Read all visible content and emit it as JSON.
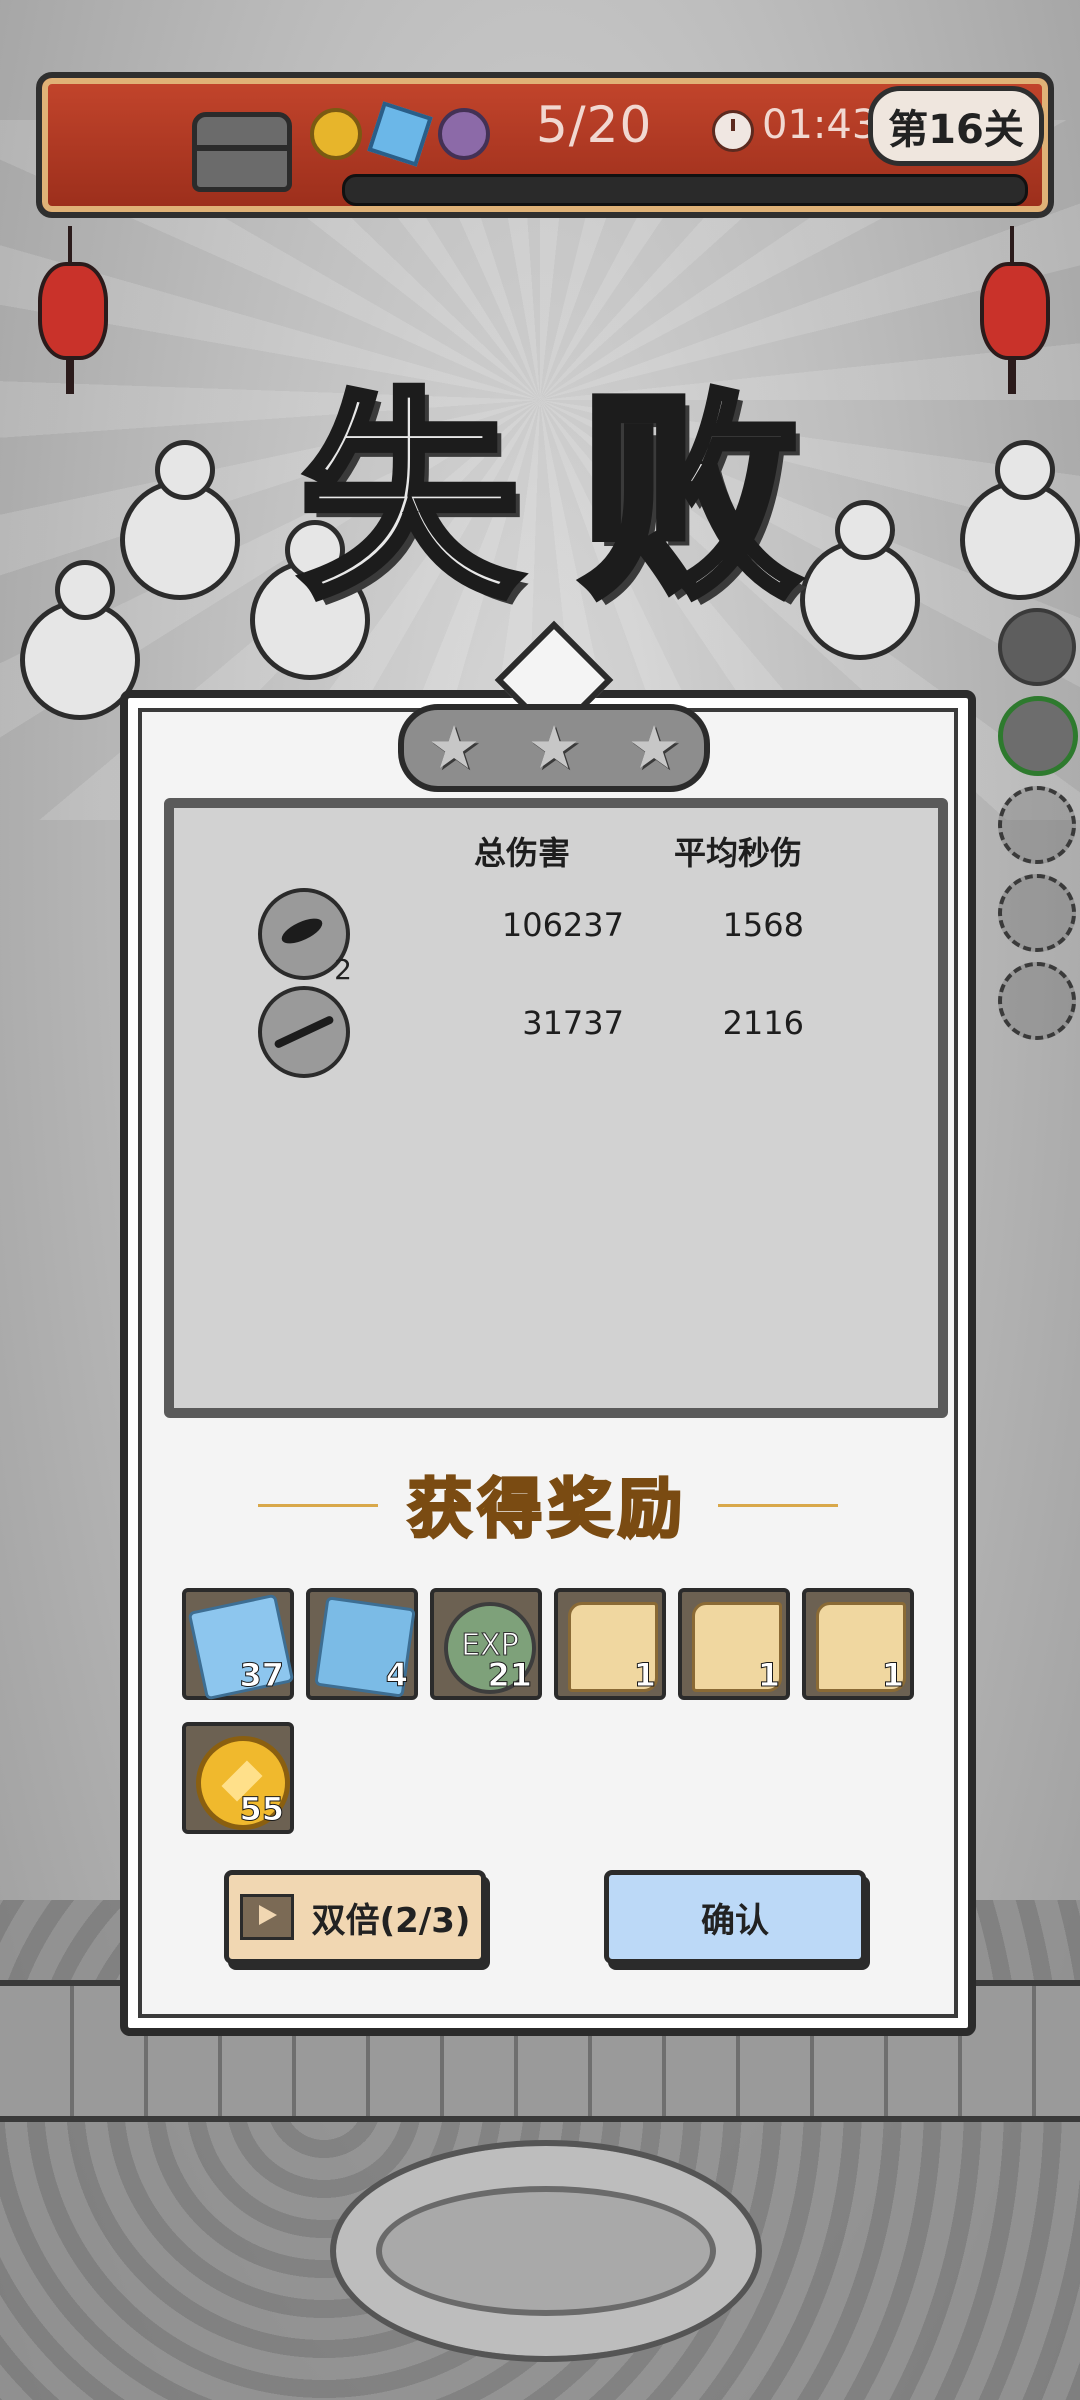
{
  "hud": {
    "wave": "5/20",
    "timer": "01:43",
    "level": "第16关",
    "progress_percent": 0,
    "icons": [
      "chest-icon",
      "coin-icon",
      "crystal-icon",
      "monster-icon",
      "clock-icon"
    ]
  },
  "result": {
    "title_chars": [
      "失",
      "败"
    ],
    "stars_earned": 0,
    "stars_total": 3
  },
  "stats": {
    "headers": [
      "总伤害",
      "平均秒伤"
    ],
    "rows": [
      {
        "icon": "ink-blot-skill-icon",
        "level": "2",
        "total": "106237",
        "avg": "1568"
      },
      {
        "icon": "ink-streak-skill-icon",
        "level": "",
        "total": "31737",
        "avg": "2116"
      }
    ]
  },
  "rewards": {
    "title": "获得奖励",
    "items": [
      {
        "name": "lightning-crystal-icon",
        "count": "37"
      },
      {
        "name": "ice-crystal-icon",
        "count": "4"
      },
      {
        "name": "exp-orb-icon",
        "label": "EXP",
        "count": "21"
      },
      {
        "name": "scroll-icon-1",
        "count": "1"
      },
      {
        "name": "scroll-icon-2",
        "count": "1"
      },
      {
        "name": "scroll-icon-3",
        "count": "1"
      },
      {
        "name": "gold-coin-icon",
        "count": "55"
      }
    ]
  },
  "buttons": {
    "double": "双倍(2/3)",
    "confirm": "确认"
  },
  "colors": {
    "hud_red": "#b03a22",
    "gold_text": "#f2b93a",
    "confirm_blue": "#bcd9f7",
    "double_tan": "#f1d7b2"
  }
}
